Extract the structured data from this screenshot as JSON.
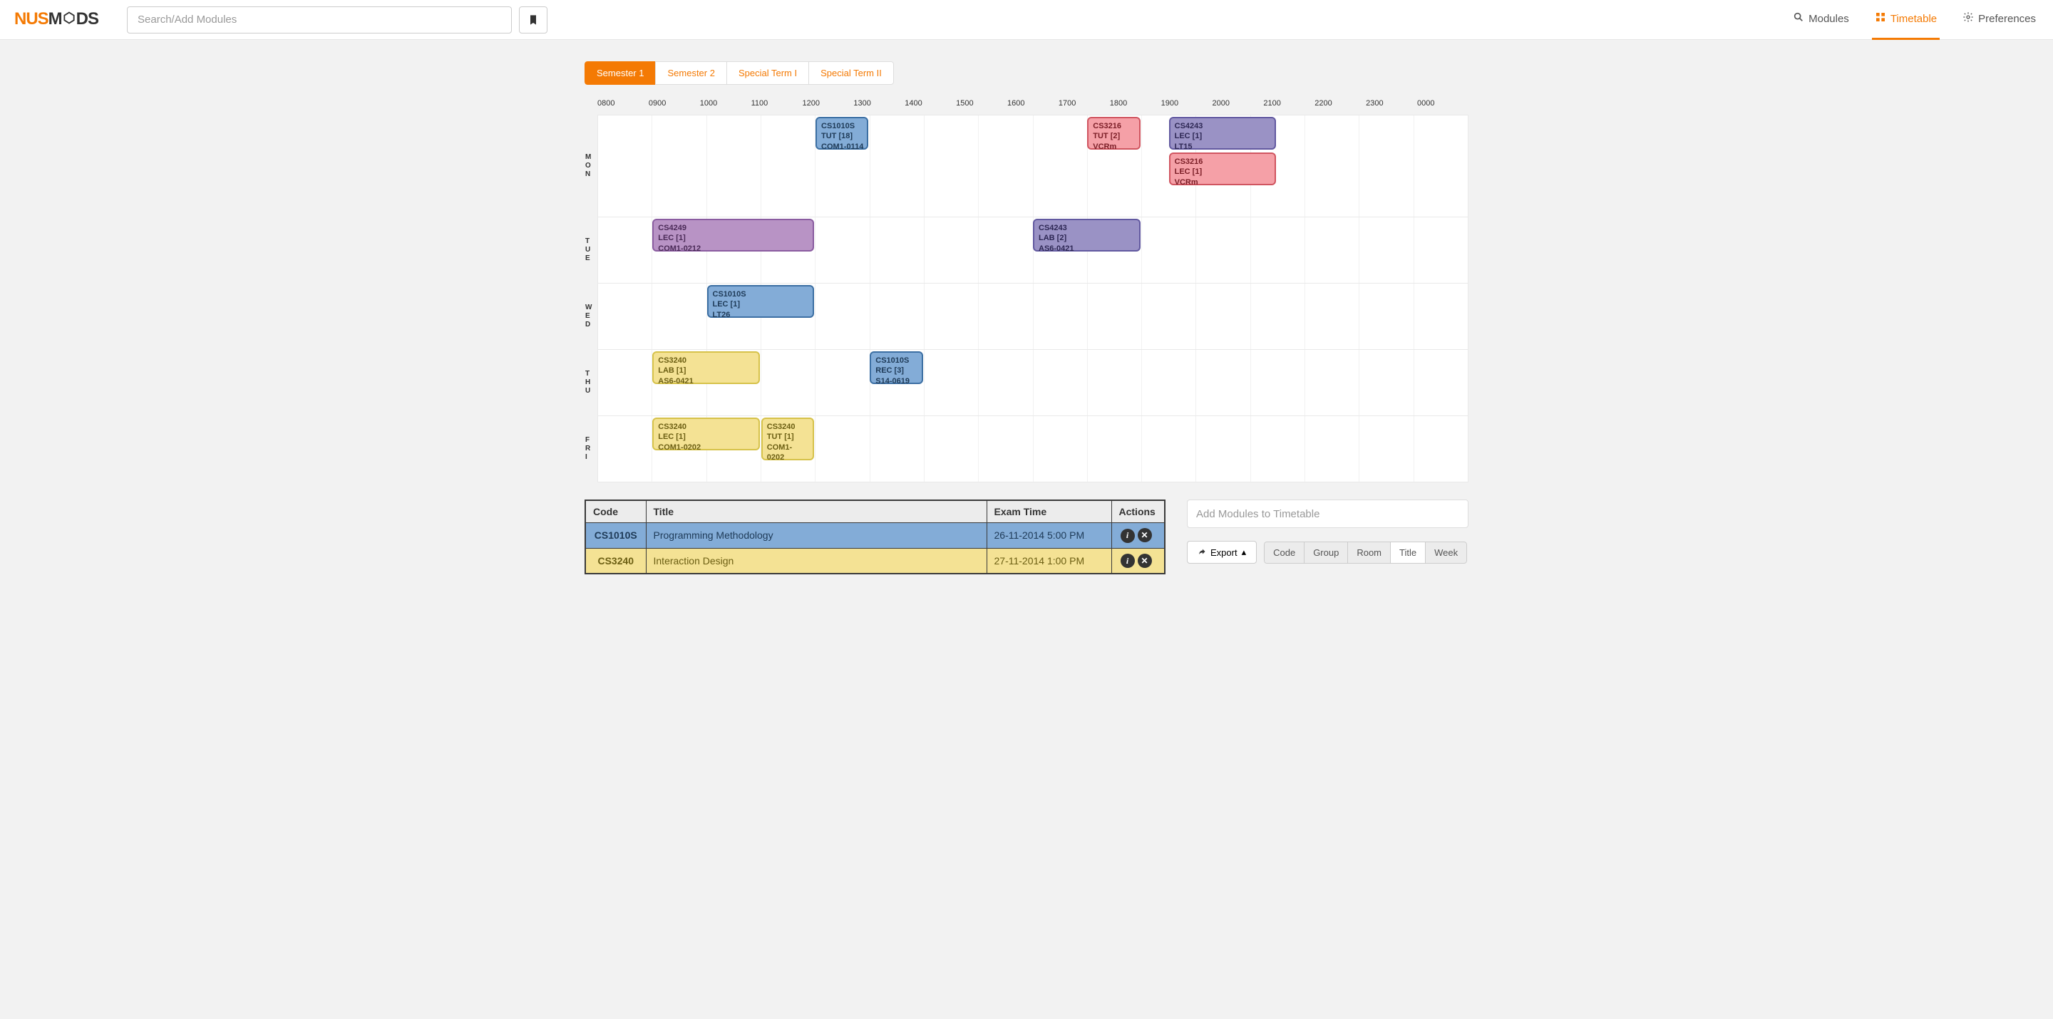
{
  "header": {
    "logo_left": "NUS",
    "logo_right": "M",
    "logo_end": "DS",
    "search_placeholder": "Search/Add Modules",
    "nav": [
      {
        "label": "Modules",
        "icon": "search-icon"
      },
      {
        "label": "Timetable",
        "icon": "grid-icon",
        "active": true
      },
      {
        "label": "Preferences",
        "icon": "gear-icon"
      }
    ]
  },
  "semesters": [
    {
      "label": "Semester 1",
      "active": true
    },
    {
      "label": "Semester 2"
    },
    {
      "label": "Special Term I"
    },
    {
      "label": "Special Term II"
    }
  ],
  "hours": [
    "0800",
    "0900",
    "1000",
    "1100",
    "1200",
    "1300",
    "1400",
    "1500",
    "1600",
    "1700",
    "1800",
    "1900",
    "2000",
    "2100",
    "2200",
    "2300",
    "0000"
  ],
  "days": [
    "MON",
    "TUE",
    "WED",
    "THU",
    "FRI"
  ],
  "blocks": {
    "mon": [
      {
        "code": "CS1010S",
        "type": "TUT [18]",
        "room": "COM1-0114",
        "color": "blue",
        "start": 12,
        "end": 13,
        "row": 0
      },
      {
        "code": "CS3216",
        "type": "TUT [2]",
        "room": "VCRm",
        "color": "red",
        "start": 17,
        "end": 18,
        "row": 0
      },
      {
        "code": "CS4243",
        "type": "LEC [1]",
        "room": "LT15",
        "color": "purple",
        "start": 18.5,
        "end": 20.5,
        "row": 0
      },
      {
        "code": "CS3216",
        "type": "LEC [1]",
        "room": "VCRm",
        "color": "red",
        "start": 18.5,
        "end": 20.5,
        "row": 1
      }
    ],
    "tue": [
      {
        "code": "CS4249",
        "type": "LEC [1]",
        "room": "COM1-0212",
        "color": "lilac",
        "start": 9,
        "end": 12,
        "row": 0
      },
      {
        "code": "CS4243",
        "type": "LAB [2]",
        "room": "AS6-0421",
        "color": "purple",
        "start": 16,
        "end": 18,
        "row": 0
      }
    ],
    "wed": [
      {
        "code": "CS1010S",
        "type": "LEC [1]",
        "room": "LT26",
        "color": "blue",
        "start": 10,
        "end": 12,
        "row": 0
      }
    ],
    "thu": [
      {
        "code": "CS3240",
        "type": "LAB [1]",
        "room": "AS6-0421",
        "color": "yellow",
        "start": 9,
        "end": 11,
        "row": 0
      },
      {
        "code": "CS1010S",
        "type": "REC [3]",
        "room": "S14-0619",
        "color": "blue",
        "start": 13,
        "end": 14,
        "row": 0
      }
    ],
    "fri": [
      {
        "code": "CS3240",
        "type": "LEC [1]",
        "room": "COM1-0202",
        "color": "yellow",
        "start": 9,
        "end": 11,
        "row": 0
      },
      {
        "code": "CS3240",
        "type": "TUT [1]",
        "room": "COM1-0202",
        "color": "yellow",
        "start": 11,
        "end": 12,
        "row": 0,
        "wrap": true
      }
    ]
  },
  "table": {
    "headers": {
      "code": "Code",
      "title": "Title",
      "exam": "Exam Time",
      "actions": "Actions"
    },
    "rows": [
      {
        "code": "CS1010S",
        "title": "Programming Methodology",
        "exam": "26-11-2014 5:00 PM",
        "color": "blue"
      },
      {
        "code": "CS3240",
        "title": "Interaction Design",
        "exam": "27-11-2014 1:00 PM",
        "color": "yellow"
      }
    ]
  },
  "side": {
    "add_placeholder": "Add Modules to Timetable",
    "export_label": "Export",
    "views": [
      {
        "label": "Code"
      },
      {
        "label": "Group"
      },
      {
        "label": "Room"
      },
      {
        "label": "Title",
        "active": true
      },
      {
        "label": "Week"
      }
    ]
  }
}
